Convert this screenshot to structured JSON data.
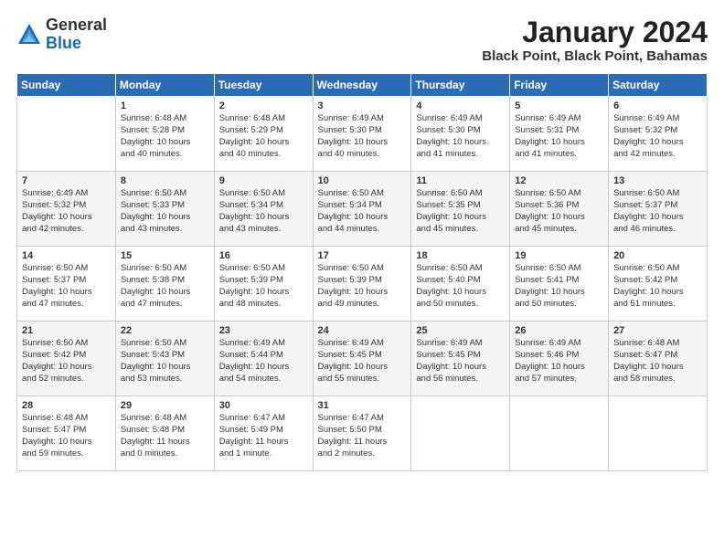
{
  "logo": {
    "general": "General",
    "blue": "Blue"
  },
  "title": "January 2024",
  "subtitle": "Black Point, Black Point, Bahamas",
  "days_of_week": [
    "Sunday",
    "Monday",
    "Tuesday",
    "Wednesday",
    "Thursday",
    "Friday",
    "Saturday"
  ],
  "weeks": [
    [
      {
        "day": "",
        "text": ""
      },
      {
        "day": "1",
        "text": "Sunrise: 6:48 AM\nSunset: 5:28 PM\nDaylight: 10 hours\nand 40 minutes."
      },
      {
        "day": "2",
        "text": "Sunrise: 6:48 AM\nSunset: 5:29 PM\nDaylight: 10 hours\nand 40 minutes."
      },
      {
        "day": "3",
        "text": "Sunrise: 6:49 AM\nSunset: 5:30 PM\nDaylight: 10 hours\nand 40 minutes."
      },
      {
        "day": "4",
        "text": "Sunrise: 6:49 AM\nSunset: 5:30 PM\nDaylight: 10 hours\nand 41 minutes."
      },
      {
        "day": "5",
        "text": "Sunrise: 6:49 AM\nSunset: 5:31 PM\nDaylight: 10 hours\nand 41 minutes."
      },
      {
        "day": "6",
        "text": "Sunrise: 6:49 AM\nSunset: 5:32 PM\nDaylight: 10 hours\nand 42 minutes."
      }
    ],
    [
      {
        "day": "7",
        "text": "Sunrise: 6:49 AM\nSunset: 5:32 PM\nDaylight: 10 hours\nand 42 minutes."
      },
      {
        "day": "8",
        "text": "Sunrise: 6:50 AM\nSunset: 5:33 PM\nDaylight: 10 hours\nand 43 minutes."
      },
      {
        "day": "9",
        "text": "Sunrise: 6:50 AM\nSunset: 5:34 PM\nDaylight: 10 hours\nand 43 minutes."
      },
      {
        "day": "10",
        "text": "Sunrise: 6:50 AM\nSunset: 5:34 PM\nDaylight: 10 hours\nand 44 minutes."
      },
      {
        "day": "11",
        "text": "Sunrise: 6:50 AM\nSunset: 5:35 PM\nDaylight: 10 hours\nand 45 minutes."
      },
      {
        "day": "12",
        "text": "Sunrise: 6:50 AM\nSunset: 5:36 PM\nDaylight: 10 hours\nand 45 minutes."
      },
      {
        "day": "13",
        "text": "Sunrise: 6:50 AM\nSunset: 5:37 PM\nDaylight: 10 hours\nand 46 minutes."
      }
    ],
    [
      {
        "day": "14",
        "text": "Sunrise: 6:50 AM\nSunset: 5:37 PM\nDaylight: 10 hours\nand 47 minutes."
      },
      {
        "day": "15",
        "text": "Sunrise: 6:50 AM\nSunset: 5:38 PM\nDaylight: 10 hours\nand 47 minutes."
      },
      {
        "day": "16",
        "text": "Sunrise: 6:50 AM\nSunset: 5:39 PM\nDaylight: 10 hours\nand 48 minutes."
      },
      {
        "day": "17",
        "text": "Sunrise: 6:50 AM\nSunset: 5:39 PM\nDaylight: 10 hours\nand 49 minutes."
      },
      {
        "day": "18",
        "text": "Sunrise: 6:50 AM\nSunset: 5:40 PM\nDaylight: 10 hours\nand 50 minutes."
      },
      {
        "day": "19",
        "text": "Sunrise: 6:50 AM\nSunset: 5:41 PM\nDaylight: 10 hours\nand 50 minutes."
      },
      {
        "day": "20",
        "text": "Sunrise: 6:50 AM\nSunset: 5:42 PM\nDaylight: 10 hours\nand 51 minutes."
      }
    ],
    [
      {
        "day": "21",
        "text": "Sunrise: 6:50 AM\nSunset: 5:42 PM\nDaylight: 10 hours\nand 52 minutes."
      },
      {
        "day": "22",
        "text": "Sunrise: 6:50 AM\nSunset: 5:43 PM\nDaylight: 10 hours\nand 53 minutes."
      },
      {
        "day": "23",
        "text": "Sunrise: 6:49 AM\nSunset: 5:44 PM\nDaylight: 10 hours\nand 54 minutes."
      },
      {
        "day": "24",
        "text": "Sunrise: 6:49 AM\nSunset: 5:45 PM\nDaylight: 10 hours\nand 55 minutes."
      },
      {
        "day": "25",
        "text": "Sunrise: 6:49 AM\nSunset: 5:45 PM\nDaylight: 10 hours\nand 56 minutes."
      },
      {
        "day": "26",
        "text": "Sunrise: 6:49 AM\nSunset: 5:46 PM\nDaylight: 10 hours\nand 57 minutes."
      },
      {
        "day": "27",
        "text": "Sunrise: 6:48 AM\nSunset: 5:47 PM\nDaylight: 10 hours\nand 58 minutes."
      }
    ],
    [
      {
        "day": "28",
        "text": "Sunrise: 6:48 AM\nSunset: 5:47 PM\nDaylight: 10 hours\nand 59 minutes."
      },
      {
        "day": "29",
        "text": "Sunrise: 6:48 AM\nSunset: 5:48 PM\nDaylight: 11 hours\nand 0 minutes."
      },
      {
        "day": "30",
        "text": "Sunrise: 6:47 AM\nSunset: 5:49 PM\nDaylight: 11 hours\nand 1 minute."
      },
      {
        "day": "31",
        "text": "Sunrise: 6:47 AM\nSunset: 5:50 PM\nDaylight: 11 hours\nand 2 minutes."
      },
      {
        "day": "",
        "text": ""
      },
      {
        "day": "",
        "text": ""
      },
      {
        "day": "",
        "text": ""
      }
    ]
  ]
}
